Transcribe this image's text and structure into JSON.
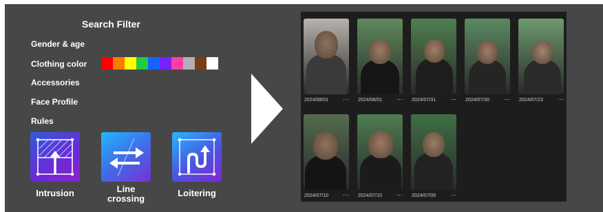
{
  "filter": {
    "title": "Search Filter",
    "rows": {
      "gender_age": "Gender & age",
      "clothing_color": "Clothing color",
      "accessories": "Accessories",
      "face_profile": "Face Profile",
      "rules": "Rules"
    },
    "colors": [
      "#ff0000",
      "#ff7a00",
      "#ffff00",
      "#22cc44",
      "#1464ff",
      "#7a1fff",
      "#ff3ea5",
      "#b0b0b0",
      "#7a3d13",
      "#ffffff"
    ],
    "rules": [
      {
        "label": "Intrusion",
        "icon": "intrusion-icon"
      },
      {
        "label_line1": "Line",
        "label_line2": "crossing",
        "icon": "line-crossing-icon"
      },
      {
        "label": "Loitering",
        "icon": "loitering-icon"
      }
    ]
  },
  "results": {
    "thumbnails": [
      {
        "date": "2024/08/01",
        "more": "···"
      },
      {
        "date": "2024/08/01",
        "more": "···"
      },
      {
        "date": "2024/07/31",
        "more": "···"
      },
      {
        "date": "2024/07/30",
        "more": "···"
      },
      {
        "date": "2024/07/23",
        "more": "···"
      },
      {
        "date": "2024/07/10",
        "more": "···"
      },
      {
        "date": "2024/07/10",
        "more": "···"
      },
      {
        "date": "2024/07/09",
        "more": "···"
      }
    ]
  }
}
